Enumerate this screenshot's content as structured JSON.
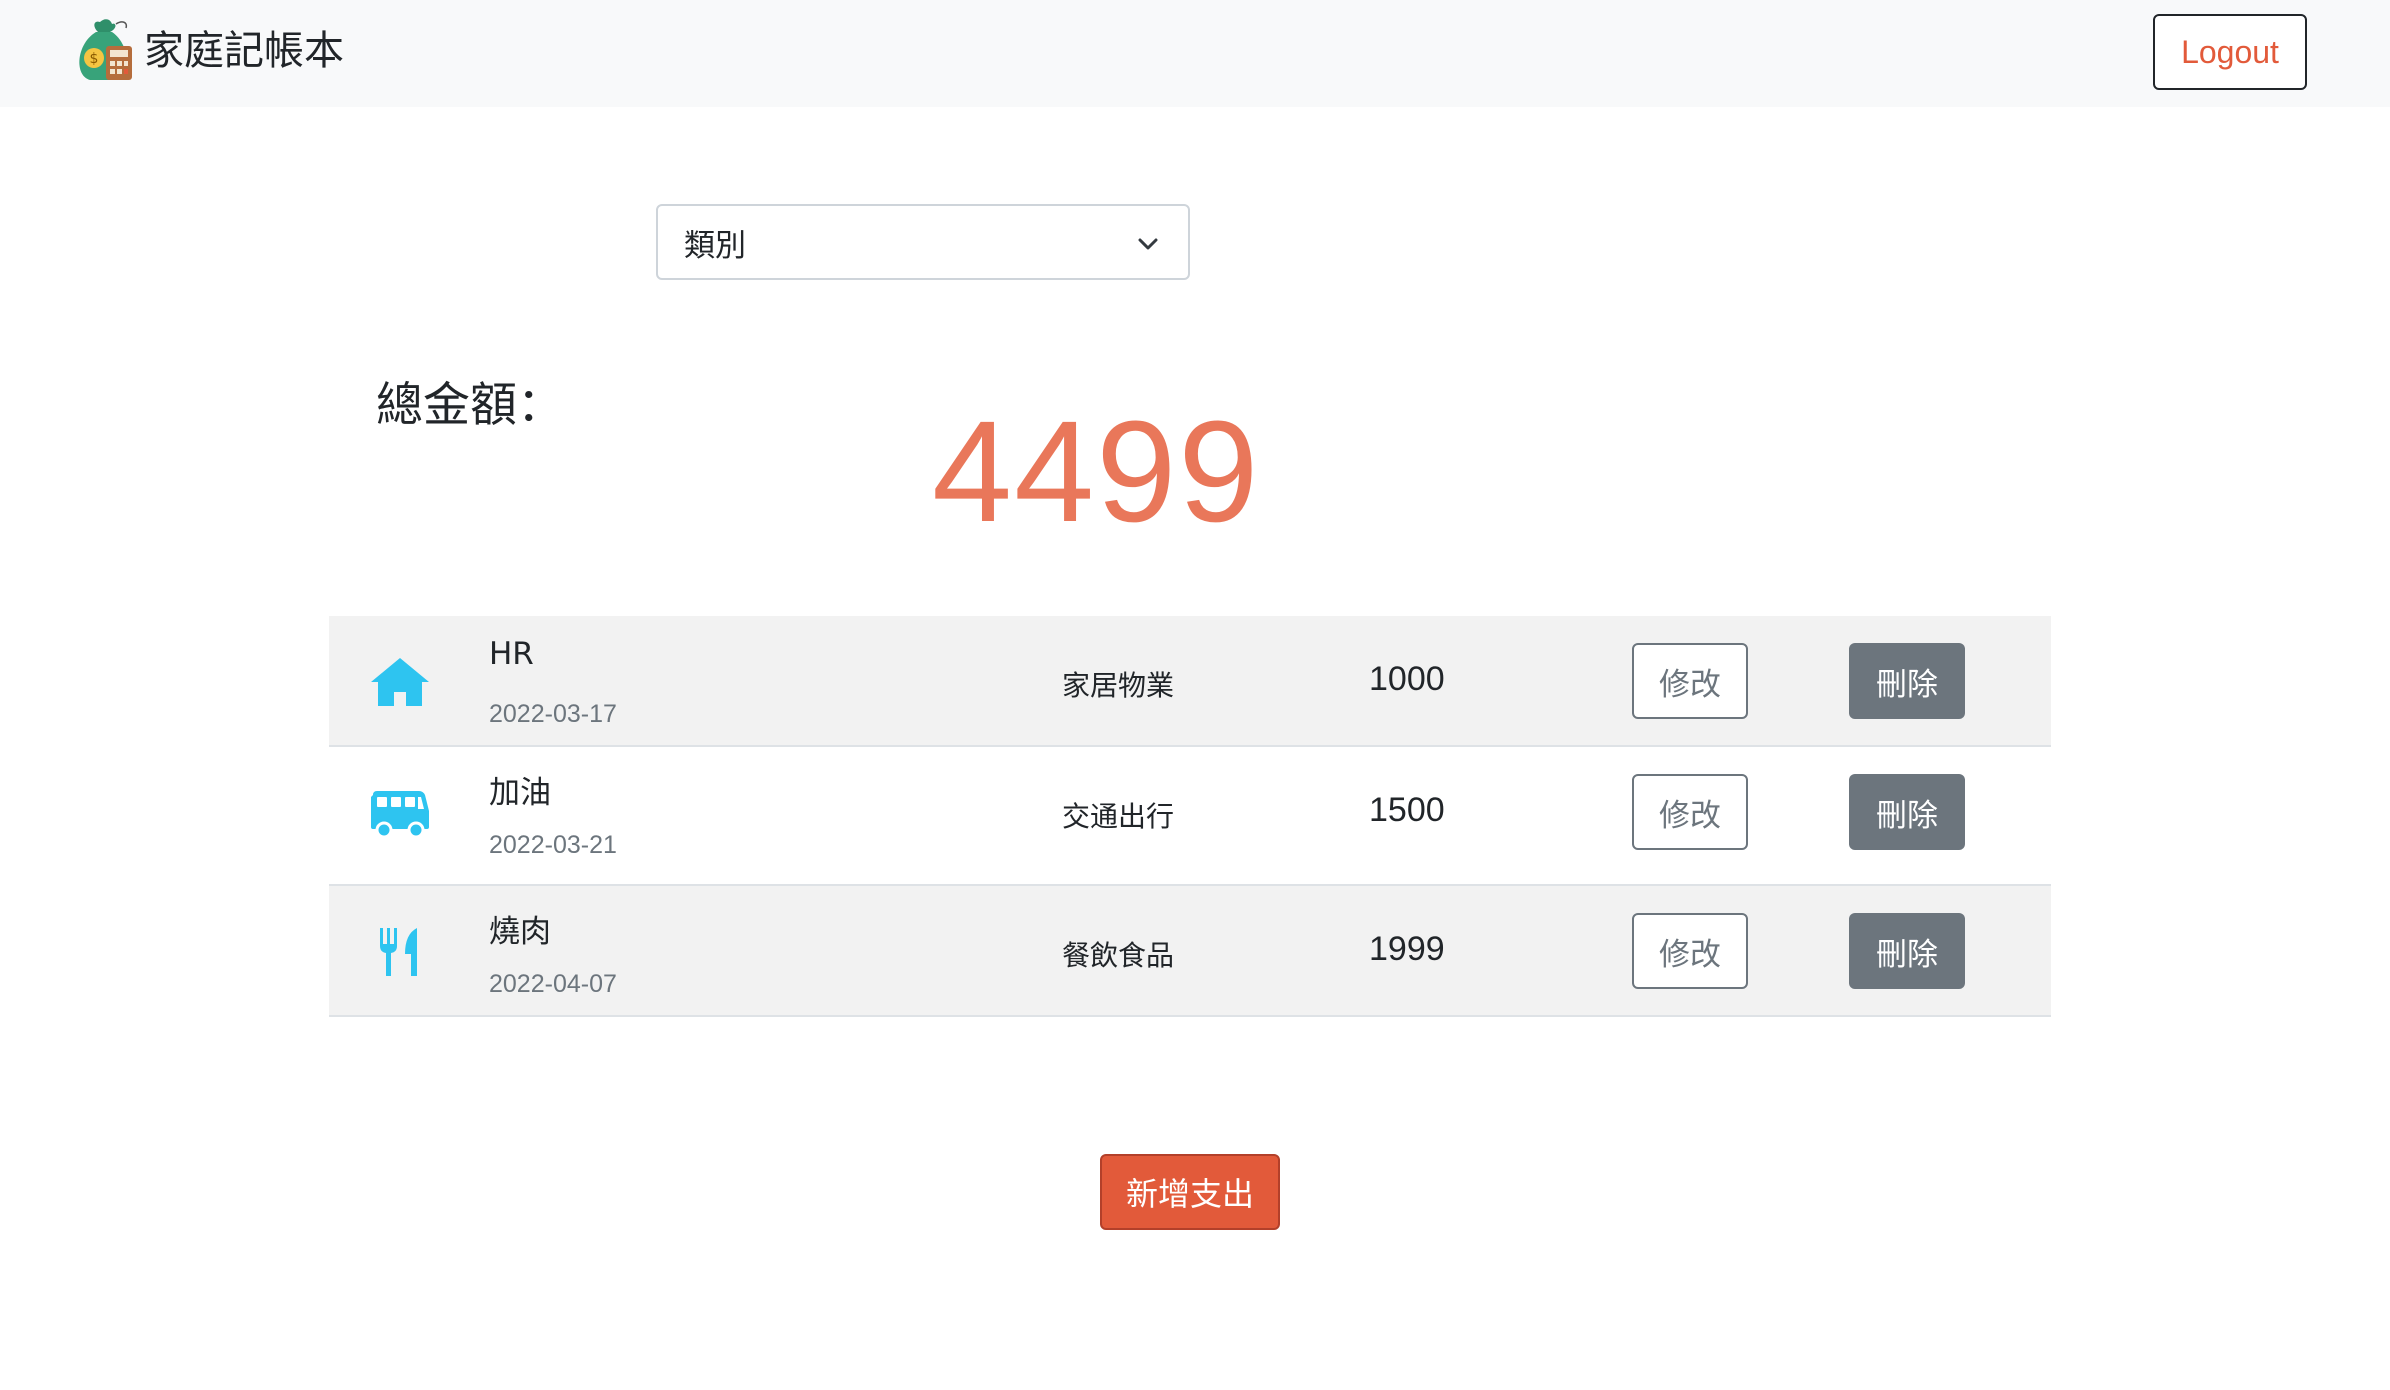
{
  "app": {
    "title": "家庭記帳本",
    "logout_label": "Logout"
  },
  "filter": {
    "selected": "類別"
  },
  "summary": {
    "label": "總金額：",
    "total": "4499"
  },
  "expenses": [
    {
      "icon": "home-icon",
      "name": "HR",
      "date": "2022-03-17",
      "category": "家居物業",
      "amount": "1000",
      "edit_label": "修改",
      "delete_label": "刪除"
    },
    {
      "icon": "van-icon",
      "name": "加油",
      "date": "2022-03-21",
      "category": "交通出行",
      "amount": "1500",
      "edit_label": "修改",
      "delete_label": "刪除"
    },
    {
      "icon": "utensils-icon",
      "name": "燒肉",
      "date": "2022-04-07",
      "category": "餐飲食品",
      "amount": "1999",
      "edit_label": "修改",
      "delete_label": "刪除"
    }
  ],
  "actions": {
    "add_label": "新增支出"
  },
  "colors": {
    "accent": "#e25a3a",
    "total": "#e9775a",
    "icon": "#2ec4f0",
    "secondary": "#6c757d"
  }
}
